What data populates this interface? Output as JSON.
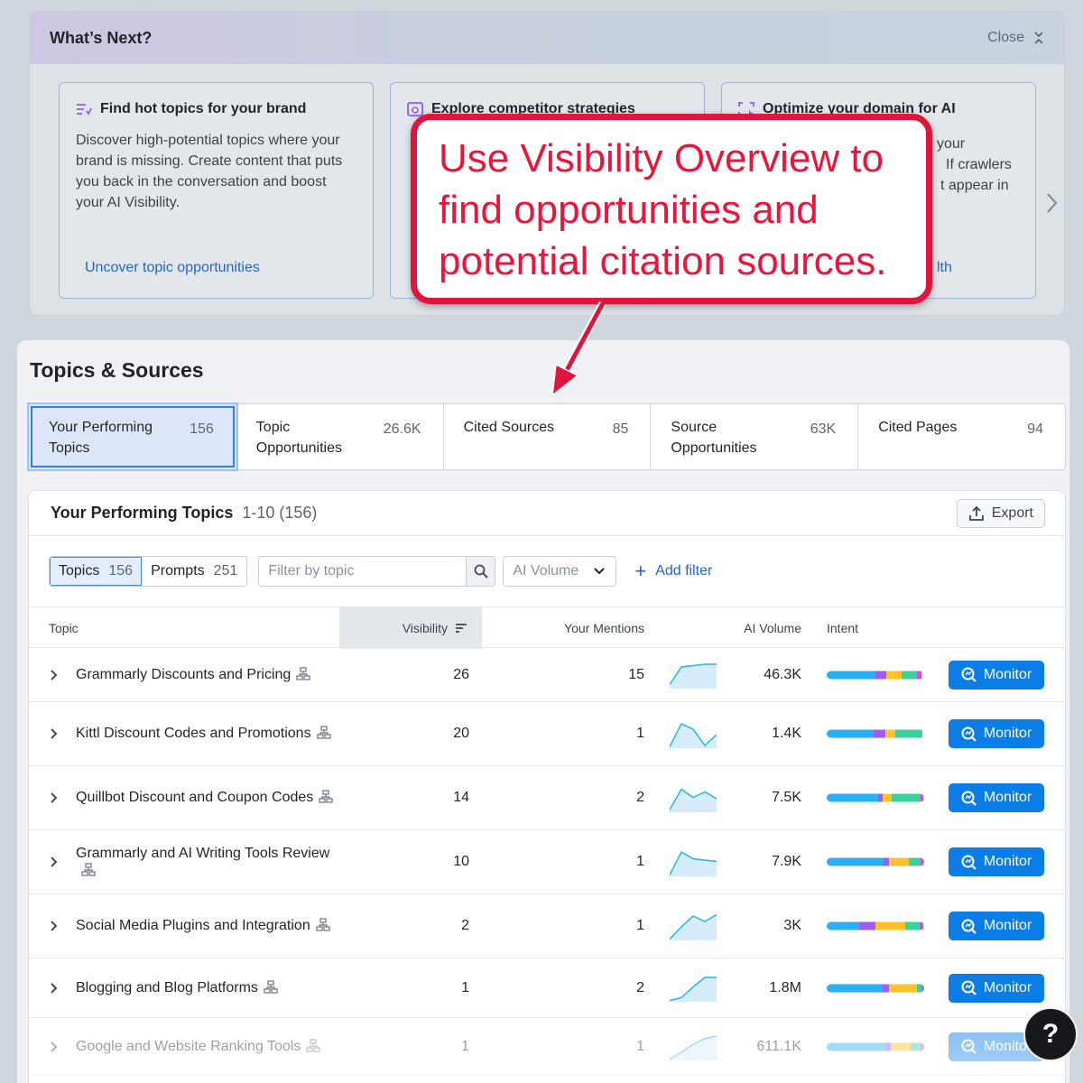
{
  "whats_next": {
    "title": "What’s Next?",
    "close_label": "Close",
    "cards": [
      {
        "title": "Find hot topics for your brand",
        "desc": "Discover high-potential topics where your brand is missing. Create content that puts you back in the conversation and boost your AI Visibility.",
        "link": "Uncover topic opportunities"
      },
      {
        "title": "Explore competitor strategies",
        "desc": "",
        "link": ""
      },
      {
        "title": "Optimize your domain for AI",
        "desc_visible_parts": [
          "your",
          "If crawlers",
          "t appear in"
        ],
        "link": "lth"
      }
    ]
  },
  "callout": {
    "text": "Use Visibility Overview to find opportunities and potential citation sources."
  },
  "topics_sources": {
    "title": "Topics & Sources",
    "tabs": [
      {
        "label": "Your Performing Topics",
        "count": "156",
        "active": true
      },
      {
        "label": "Topic Opportunities",
        "count": "26.6K",
        "active": false
      },
      {
        "label": "Cited Sources",
        "count": "85",
        "active": false
      },
      {
        "label": "Source Opportunities",
        "count": "63K",
        "active": false
      },
      {
        "label": "Cited Pages",
        "count": "94",
        "active": false
      }
    ]
  },
  "panel": {
    "title": "Your Performing Topics",
    "range": "1-10 (156)",
    "export_label": "Export",
    "filters": {
      "seg": [
        {
          "label": "Topics",
          "count": "156",
          "active": true
        },
        {
          "label": "Prompts",
          "count": "251",
          "active": false
        }
      ],
      "search_placeholder": "Filter by topic",
      "volume_label": "AI Volume",
      "add_filter": "Add filter"
    },
    "columns": {
      "topic": "Topic",
      "visibility": "Visibility",
      "mentions": "Your Mentions",
      "volume": "AI Volume",
      "intent": "Intent"
    },
    "monitor_label": "Monitor",
    "intent_colors": {
      "informational": "#2ab0f2",
      "navigational": "#9d5cf3",
      "commercial": "#fdc12a",
      "transactional": "#3ad29a",
      "other": "#d24ce6"
    },
    "rows": [
      {
        "topic": "Grammarly Discounts and Pricing",
        "visibility": "26",
        "mentions": "15",
        "volume": "46.3K",
        "intent": [
          0.5,
          0.11,
          0.16,
          0.16,
          0.04
        ],
        "spark": [
          0.15,
          0.8,
          0.85,
          0.9,
          0.9
        ]
      },
      {
        "topic": "Kittl Discount Codes and Promotions",
        "visibility": "20",
        "mentions": "1",
        "volume": "1.4K",
        "intent": [
          0.48,
          0.12,
          0.1,
          0.28,
          0
        ],
        "spark": [
          0.05,
          0.9,
          0.7,
          0.1,
          0.5
        ]
      },
      {
        "topic": "Quillbot Discount and Coupon Codes",
        "visibility": "14",
        "mentions": "2",
        "volume": "7.5K",
        "intent": [
          0.53,
          0.04,
          0.1,
          0.29,
          0.03
        ],
        "spark": [
          0.1,
          0.85,
          0.55,
          0.75,
          0.5
        ]
      },
      {
        "topic": "Grammarly and AI Writing Tools Review",
        "visibility": "10",
        "mentions": "1",
        "volume": "7.9K",
        "intent": [
          0.58,
          0.06,
          0.2,
          0.12,
          0.04
        ],
        "spark": [
          0.05,
          0.9,
          0.65,
          0.6,
          0.55
        ]
      },
      {
        "topic": "Social Media Plugins and Integration",
        "visibility": "2",
        "mentions": "1",
        "volume": "3K",
        "intent": [
          0.33,
          0.17,
          0.31,
          0.14,
          0.04
        ],
        "spark": [
          0.05,
          0.5,
          0.9,
          0.7,
          0.95
        ]
      },
      {
        "topic": "Blogging and Blog Platforms",
        "visibility": "1",
        "mentions": "2",
        "volume": "1.8M",
        "intent": [
          0.57,
          0.07,
          0.29,
          0.04,
          0.03
        ],
        "spark": [
          0.05,
          0.15,
          0.55,
          0.9,
          0.9
        ]
      },
      {
        "topic": "Google and Website Ranking Tools",
        "visibility": "1",
        "mentions": "1",
        "volume": "611.1K",
        "intent": [
          0.6,
          0.06,
          0.2,
          0.1,
          0.04
        ],
        "spark": [
          0.05,
          0.3,
          0.6,
          0.8,
          0.9
        ]
      }
    ]
  },
  "help_label": "?"
}
